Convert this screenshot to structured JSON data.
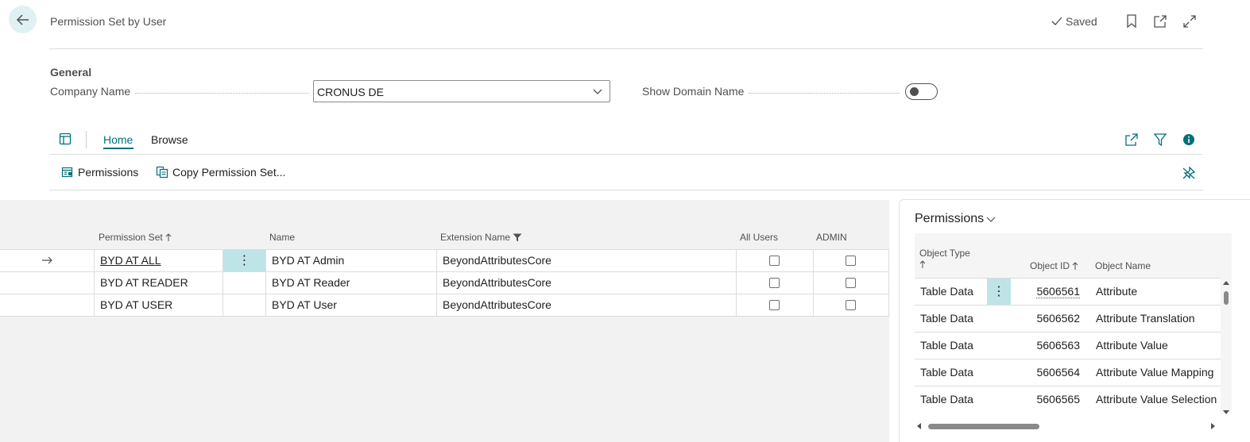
{
  "header": {
    "title": "Permission Set by User",
    "saved_label": "Saved"
  },
  "general": {
    "section_title": "General",
    "company_label": "Company Name",
    "company_value": "CRONUS DE",
    "show_domain_label": "Show Domain Name",
    "show_domain_on": false
  },
  "tabs": [
    {
      "label": "Home",
      "active": true
    },
    {
      "label": "Browse",
      "active": false
    }
  ],
  "actions": {
    "permissions_label": "Permissions",
    "copy_label": "Copy Permission Set..."
  },
  "list": {
    "columns": {
      "permission_set": "Permission Set",
      "name": "Name",
      "extension_name": "Extension Name",
      "all_users": "All Users",
      "admin": "ADMIN"
    },
    "rows": [
      {
        "permission_set": "BYD AT ALL",
        "name": "BYD AT Admin",
        "extension_name": "BeyondAttributesCore",
        "selected": true
      },
      {
        "permission_set": "BYD AT READER",
        "name": "BYD AT Reader",
        "extension_name": "BeyondAttributesCore",
        "selected": false
      },
      {
        "permission_set": "BYD AT USER",
        "name": "BYD AT User",
        "extension_name": "BeyondAttributesCore",
        "selected": false
      }
    ]
  },
  "factbox": {
    "title": "Permissions",
    "columns": {
      "object_type": "Object Type",
      "object_id": "Object ID",
      "object_name": "Object Name"
    },
    "rows": [
      {
        "object_type": "Table Data",
        "object_id": "5606561",
        "object_name": "Attribute"
      },
      {
        "object_type": "Table Data",
        "object_id": "5606562",
        "object_name": "Attribute Translation"
      },
      {
        "object_type": "Table Data",
        "object_id": "5606563",
        "object_name": "Attribute Value"
      },
      {
        "object_type": "Table Data",
        "object_id": "5606564",
        "object_name": "Attribute Value Mapping"
      },
      {
        "object_type": "Table Data",
        "object_id": "5606565",
        "object_name": "Attribute Value Selection"
      }
    ]
  },
  "colors": {
    "accent": "#00707a",
    "selected_cell": "#bfe4e7",
    "back_button_bg": "#dff1f2"
  }
}
